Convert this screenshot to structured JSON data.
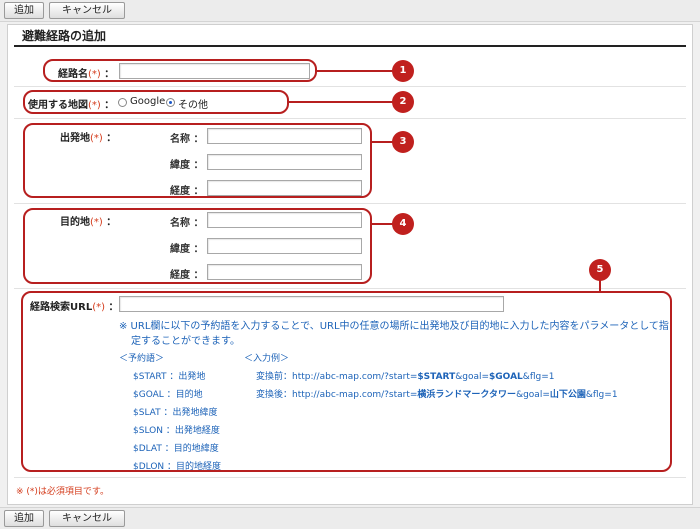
{
  "toolbar_top": {
    "add": "追加",
    "cancel": "キャンセル"
  },
  "toolbar_bottom": {
    "add": "追加",
    "cancel": "キャンセル"
  },
  "page_title": "避難経路の追加",
  "required_mark": "(*)",
  "colon": "：",
  "route_name": {
    "label": "経路名",
    "value": ""
  },
  "map_type": {
    "label": "使用する地図",
    "options": [
      "Google",
      "その他"
    ],
    "selected": "その他"
  },
  "departure": {
    "label": "出発地",
    "fields": [
      {
        "label": "名称",
        "value": ""
      },
      {
        "label": "緯度",
        "value": ""
      },
      {
        "label": "経度",
        "value": ""
      }
    ]
  },
  "destination": {
    "label": "目的地",
    "fields": [
      {
        "label": "名称",
        "value": ""
      },
      {
        "label": "緯度",
        "value": ""
      },
      {
        "label": "経度",
        "value": ""
      }
    ]
  },
  "route_url": {
    "label": "経路検索URL",
    "value": "",
    "note_line1": "※ URL欄に以下の予約語を入力することで、URL中の任意の場所に出発地及び目的地に入力した内容をパラメータとして指",
    "note_line2": "定することができます。",
    "reserved_heading": "＜予約語＞",
    "reserved": [
      {
        "key": "$START",
        "desc": "：出発地"
      },
      {
        "key": "$GOAL",
        "desc": "：目的地"
      },
      {
        "key": "$SLAT",
        "desc": "：出発地緯度"
      },
      {
        "key": "$SLON",
        "desc": "：出発地経度"
      },
      {
        "key": "$DLAT",
        "desc": "：目的地緯度"
      },
      {
        "key": "$DLON",
        "desc": "：目的地経度"
      }
    ],
    "example_heading": "＜入力例＞",
    "before": {
      "label": "変換前：",
      "p1": "http://abc-map.com/?start=",
      "k1": "$START",
      "p2": "&goal=",
      "k2": "$GOAL",
      "p3": "&flg=1"
    },
    "after": {
      "label": "変換後：",
      "p1": "http://abc-map.com/?start=",
      "k1": "横浜ランドマークタワー",
      "p2": "&goal=",
      "k2": "山下公園",
      "p3": "&flg=1"
    }
  },
  "footnote": "※ (*)は必須項目です。",
  "callouts": [
    "1",
    "2",
    "3",
    "4",
    "5"
  ],
  "colors": {
    "accent_red": "#c0201e",
    "note_blue": "#1d63b8",
    "required_orange": "#d43c1c"
  }
}
